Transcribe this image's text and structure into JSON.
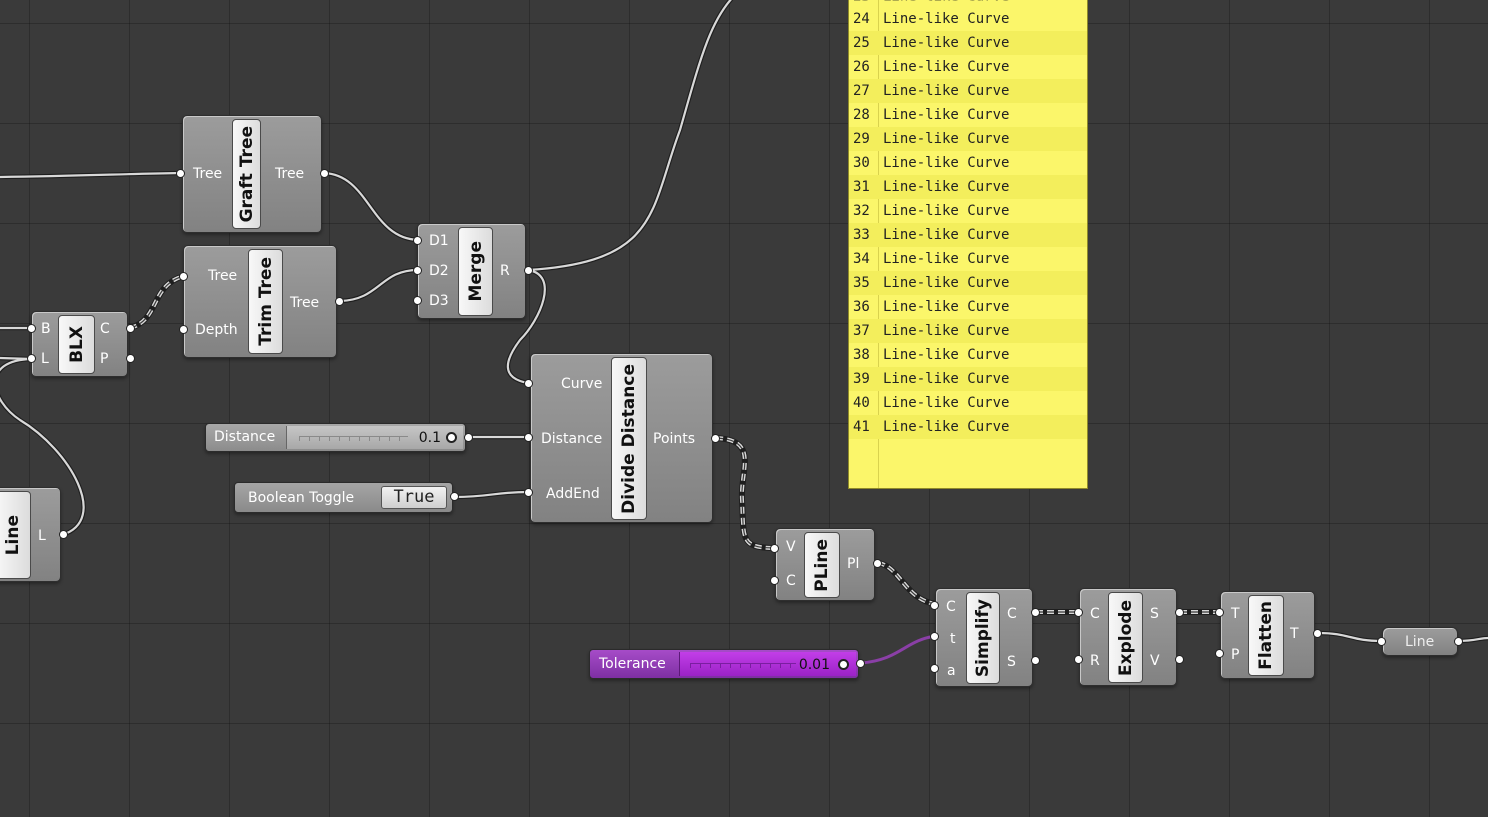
{
  "canvas": {
    "background": "#3a3a3a",
    "wire_color": "#d6d6d6",
    "wire_color_purple": "#8a3fa6",
    "panel_color": "#fbf66a",
    "tolerance_color": "#9b30c8"
  },
  "components": {
    "graft_tree": {
      "title": "Graft Tree",
      "inputs": [
        "Tree"
      ],
      "outputs": [
        "Tree"
      ]
    },
    "trim_tree": {
      "title": "Trim Tree",
      "inputs": [
        "Tree",
        "Depth"
      ],
      "outputs": [
        "Tree"
      ]
    },
    "merge": {
      "title": "Merge",
      "inputs": [
        "D1",
        "D2",
        "D3"
      ],
      "outputs": [
        "R"
      ]
    },
    "blx": {
      "title": "BLX",
      "inputs": [
        "B",
        "L"
      ],
      "outputs": [
        "C",
        "P"
      ]
    },
    "line": {
      "title": "Line",
      "outputs": [
        "L"
      ]
    },
    "divide_distance": {
      "title": "Divide Distance",
      "inputs": [
        "Curve",
        "Distance",
        "AddEnd"
      ],
      "outputs": [
        "Points"
      ]
    },
    "pline": {
      "title": "PLine",
      "inputs": [
        "V",
        "C"
      ],
      "outputs": [
        "Pl"
      ]
    },
    "simplify": {
      "title": "Simplify",
      "inputs": [
        "C",
        "t",
        "a"
      ],
      "outputs": [
        "C",
        "S"
      ]
    },
    "explode": {
      "title": "Explode",
      "inputs": [
        "C",
        "R"
      ],
      "outputs": [
        "S",
        "V"
      ]
    },
    "flatten": {
      "title": "Flatten",
      "inputs": [
        "T",
        "P"
      ],
      "outputs": [
        "T"
      ]
    },
    "line_param": {
      "title": "Line"
    }
  },
  "sliders": {
    "distance": {
      "label": "Distance",
      "value": "0.1"
    },
    "tolerance": {
      "label": "Tolerance",
      "value": "0.01"
    }
  },
  "toggle": {
    "label": "Boolean Toggle",
    "value": "True"
  },
  "panel": {
    "rows": [
      {
        "index": "24",
        "text": "Line-like Curve"
      },
      {
        "index": "25",
        "text": "Line-like Curve"
      },
      {
        "index": "26",
        "text": "Line-like Curve"
      },
      {
        "index": "27",
        "text": "Line-like Curve"
      },
      {
        "index": "28",
        "text": "Line-like Curve"
      },
      {
        "index": "29",
        "text": "Line-like Curve"
      },
      {
        "index": "30",
        "text": "Line-like Curve"
      },
      {
        "index": "31",
        "text": "Line-like Curve"
      },
      {
        "index": "32",
        "text": "Line-like Curve"
      },
      {
        "index": "33",
        "text": "Line-like Curve"
      },
      {
        "index": "34",
        "text": "Line-like Curve"
      },
      {
        "index": "35",
        "text": "Line-like Curve"
      },
      {
        "index": "36",
        "text": "Line-like Curve"
      },
      {
        "index": "37",
        "text": "Line-like Curve"
      },
      {
        "index": "38",
        "text": "Line-like Curve"
      },
      {
        "index": "39",
        "text": "Line-like Curve"
      },
      {
        "index": "40",
        "text": "Line-like Curve"
      },
      {
        "index": "41",
        "text": "Line-like Curve"
      }
    ]
  }
}
